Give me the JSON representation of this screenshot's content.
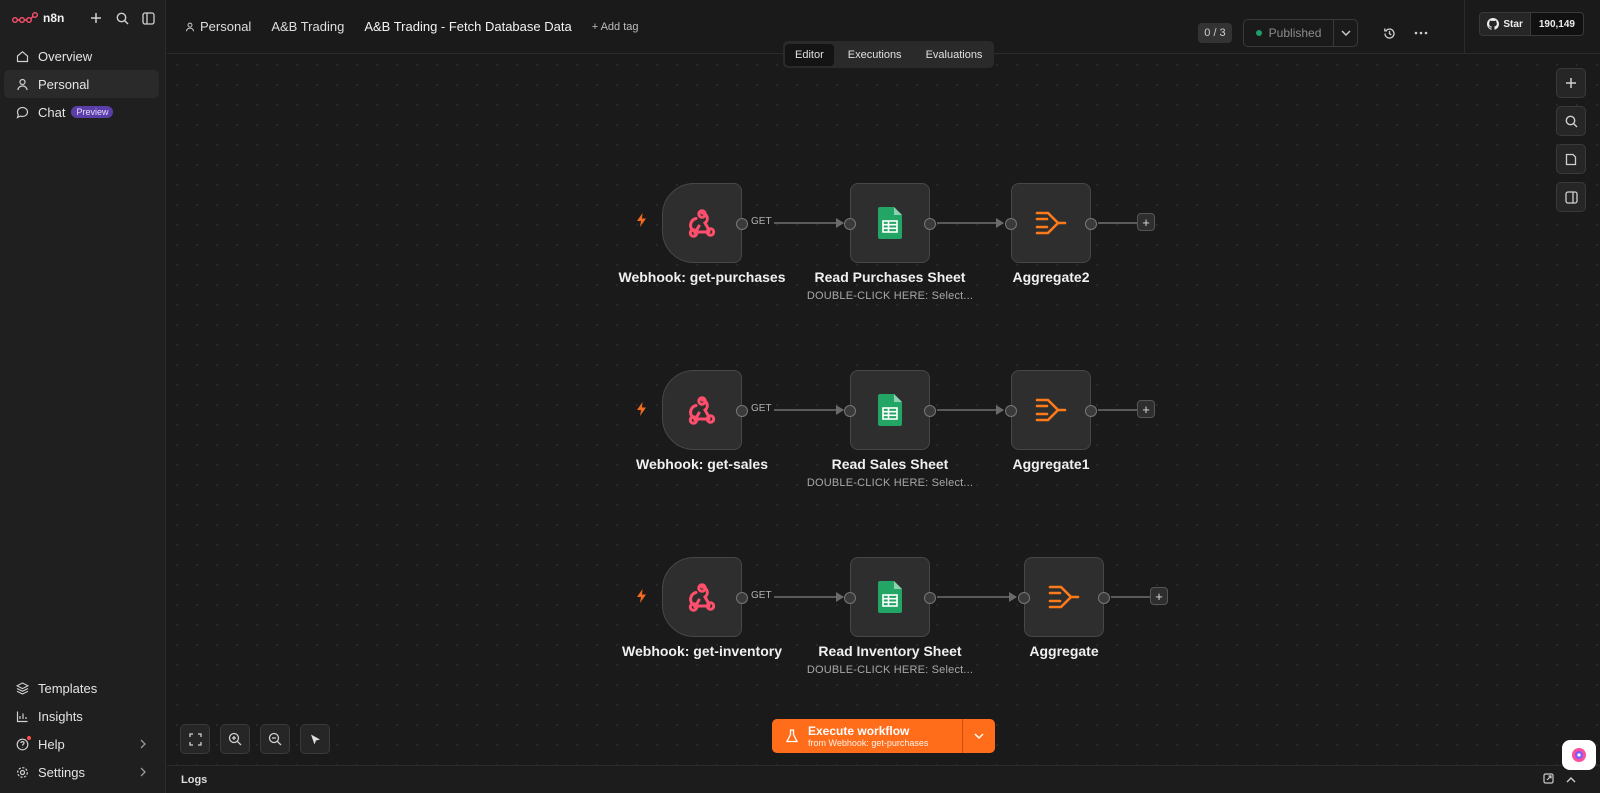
{
  "app": {
    "logo_text": "n8n"
  },
  "sidebar": {
    "items": [
      {
        "label": "Overview"
      },
      {
        "label": "Personal"
      },
      {
        "label": "Chat",
        "badge": "Preview"
      }
    ],
    "bottom": [
      {
        "label": "Templates"
      },
      {
        "label": "Insights"
      },
      {
        "label": "Help"
      },
      {
        "label": "Settings"
      }
    ]
  },
  "header": {
    "breadcrumbs": [
      "Personal",
      "A&B Trading",
      "A&B Trading - Fetch Database Data"
    ],
    "add_tag": "+ Add tag",
    "counter": "0 / 3",
    "publish_status": "Published",
    "github": {
      "star_label": "Star",
      "count": "190,149"
    }
  },
  "tabs": [
    "Editor",
    "Executions",
    "Evaluations"
  ],
  "nodes": {
    "row1": {
      "trigger": "Webhook: get-purchases",
      "sheet": "Read Purchases Sheet",
      "sheet_sub": "DOUBLE-CLICK HERE: Select...",
      "agg": "Aggregate2",
      "method": "GET"
    },
    "row2": {
      "trigger": "Webhook: get-sales",
      "sheet": "Read Sales Sheet",
      "sheet_sub": "DOUBLE-CLICK HERE: Select...",
      "agg": "Aggregate1",
      "method": "GET"
    },
    "row3": {
      "trigger": "Webhook: get-inventory",
      "sheet": "Read Inventory Sheet",
      "sheet_sub": "DOUBLE-CLICK HERE: Select...",
      "agg": "Aggregate",
      "method": "GET"
    }
  },
  "execute": {
    "label": "Execute workflow",
    "sub": "from Webhook: get-purchases"
  },
  "logs": {
    "label": "Logs"
  },
  "colors": {
    "accent": "#ff6d1a",
    "webhook": "#ff4f6d",
    "sheets": "#22a565",
    "aggregate": "#ff7a1a"
  }
}
